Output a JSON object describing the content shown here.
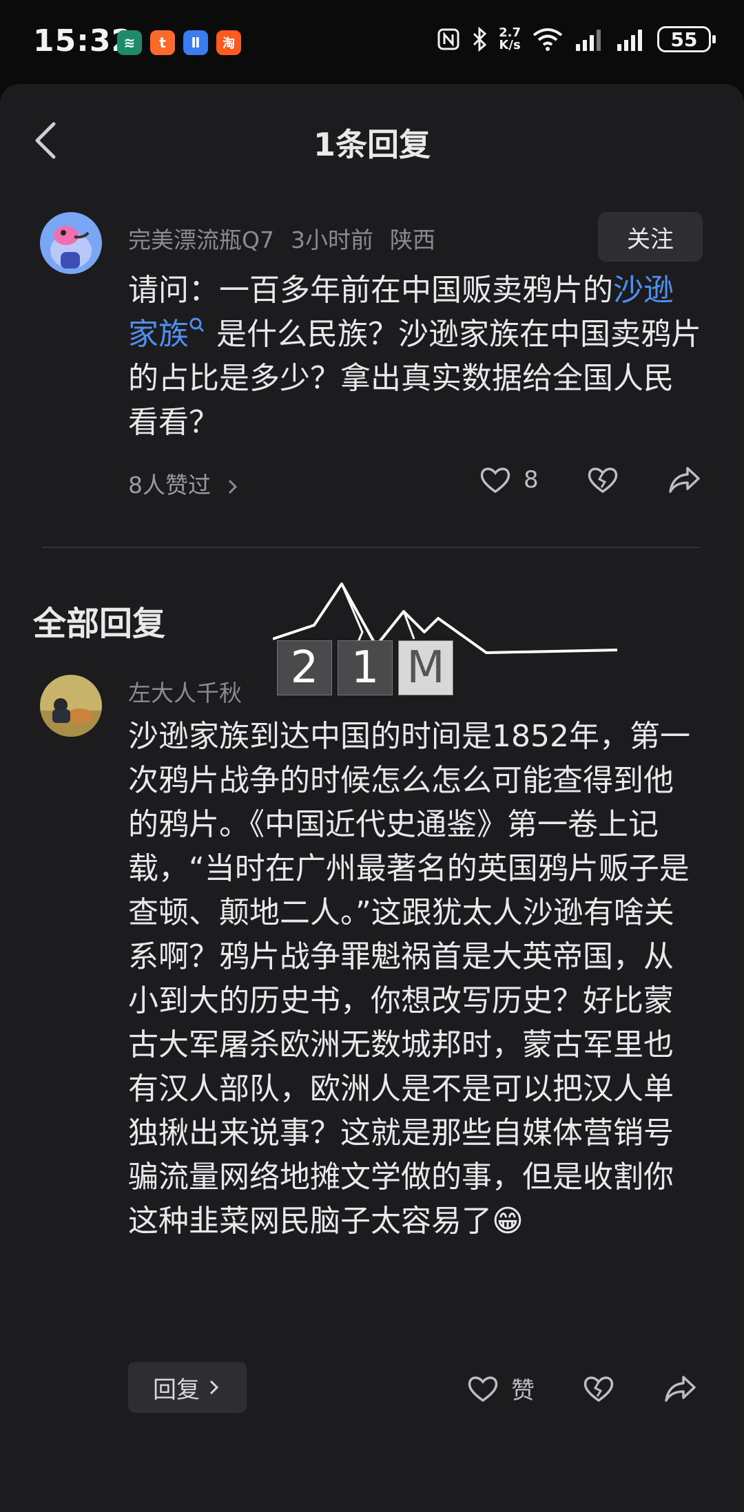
{
  "status_bar": {
    "time": "15:32",
    "speed_value": "2.7",
    "speed_unit": "K/s",
    "battery": "55",
    "app_icons": [
      {
        "name": "wallet-app-icon",
        "color": "#1f8a6a",
        "glyph": "≋"
      },
      {
        "name": "toutiao-app-icon",
        "color": "#ff6a2b",
        "glyph": "t"
      },
      {
        "name": "blue-app-icon",
        "color": "#3b7cf0",
        "glyph": "Ⅱ"
      },
      {
        "name": "taobao-app-icon",
        "color": "#ff5a1f",
        "glyph": "淘"
      }
    ]
  },
  "header": {
    "title": "1条回复"
  },
  "original_comment": {
    "author": "完美漂流瓶Q7",
    "time": "3小时前",
    "location": "陕西",
    "follow_label": "关注",
    "text_prefix": "请问：一百多年前在中国贩卖鸦片的",
    "link_text": "沙逊家族",
    "text_suffix": "是什么民族？沙逊家族在中国卖鸦片的占比是多少？拿出真实数据给全国人民看看？",
    "likes_summary": "8人赞过",
    "like_count": "8"
  },
  "section_title": "全部回复",
  "reply": {
    "author": "左大人千秋",
    "text": "沙逊家族到达中国的时间是1852年，第一次鸦片战争的时候怎么怎么可能查得到他的鸦片。《中国近代史通鉴》第一卷上记载，“当时在广州最著名的英国鸦片贩子是查顿、颠地二人。”这跟犹太人沙逊有啥关系啊？鸦片战争罪魁祸首是大英帝国，从小到大的历史书，你想改写历史？好比蒙古大军屠杀欧洲无数城邦时，蒙古军里也有汉人部队，欧洲人是不是可以把汉人单独揪出来说事？这就是那些自媒体营销号骗流量网络地摊文学做的事，但是收割你这种韭菜网民脑子太容易了",
    "emoji": "😁",
    "reply_label": "回复",
    "like_label": "赞"
  },
  "watermark": {
    "digits": [
      "2",
      "1",
      "M"
    ]
  },
  "colors": {
    "link": "#4f8ff0",
    "sheet_bg": "#1c1c1e",
    "page_bg": "#0b0b0c"
  }
}
